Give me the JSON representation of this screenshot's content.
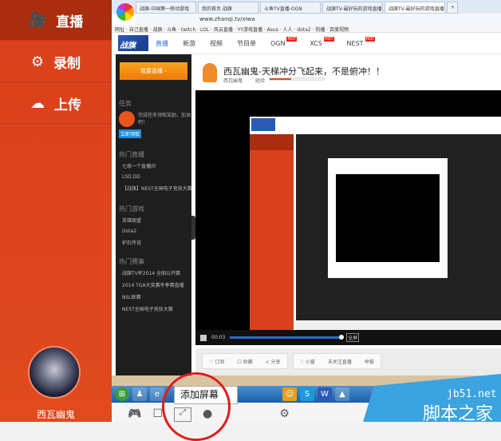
{
  "sidebar": {
    "items": [
      {
        "label": "直播",
        "icon": "🎥"
      },
      {
        "label": "录制",
        "icon": "⚙"
      },
      {
        "label": "上传",
        "icon": "☁"
      }
    ],
    "username": "西瓦幽鬼"
  },
  "browser": {
    "tabs": [
      "战旗-中国第一移动游戏",
      "我的首页 战旗",
      "斗鱼TV直播-OGN",
      "战旗TV-最好玩的游戏直播",
      "战旗TV-最好玩的游戏直播"
    ],
    "new_tab": "+",
    "address": "www.zhanqi.tv/xiwa",
    "bookmarks": "网址 · 自己直播 · 战旗 · 斗鱼 · twitch · LOL · 风云直播 · YY游戏直播 · Asus · 人人 · dota2 · 热播 · 百度视频"
  },
  "site": {
    "logo": "战旗TV",
    "nav": [
      "直播",
      "新游",
      "视频",
      "节目单",
      "OGN",
      "XCS",
      "NEST"
    ],
    "hot_badge": "HOT"
  },
  "left_panel": {
    "go_live": "我要直播 ›",
    "task_heading": "任务",
    "task_text": "完成任务领取奖励，加油吧！",
    "task_button": "立即领取",
    "hot_live": "热门直播",
    "live_items": [
      "七夜一个直播间",
      "LSD.DD",
      "【战旗】NEST全国电子竞技大赛..."
    ],
    "hot_games": "热门游戏",
    "game_items": [
      "英雄联盟",
      "Dota2",
      "炉石传说"
    ],
    "hot_events": "热门赛事",
    "event_items": [
      "战旗TV杯2014 全国公开赛",
      "2014 TGA大奖赛冬季赛直播",
      "NSL联赛",
      "NEST全国电子竞技大赛"
    ]
  },
  "stream": {
    "title": "西瓦幽鬼-天梯冲分飞起来，不是俯冲！！",
    "anchor": "西瓦幽鬼",
    "level_label": "经验",
    "progress": 0.4,
    "time": "00:03",
    "fullscreen": "全屏"
  },
  "actions": {
    "subscribe": "♡ 订阅",
    "favorite": "☐ 收藏",
    "share": "< 分享",
    "small": "♡ 小窗",
    "unfollow": "未关注直播",
    "report": "举报"
  },
  "tooltip": "添加屏幕",
  "watermark": {
    "line1": "jb51.net",
    "line2": "脚本之家"
  },
  "colors": {
    "accent": "#d9401c",
    "active": "#a92d0e"
  }
}
